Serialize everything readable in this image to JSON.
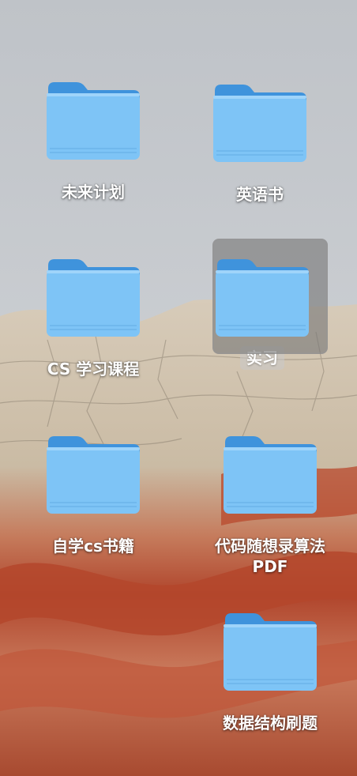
{
  "desktop": {
    "folders": [
      {
        "label": "未来计划"
      },
      {
        "label": "英语书"
      },
      {
        "label": "CS 学习课程"
      },
      {
        "label": "实习",
        "selected": true
      },
      {
        "label": "自学cs书籍"
      },
      {
        "label": "代码随想录算法\nPDF"
      },
      {
        "label": "数据结构刷题"
      }
    ]
  },
  "colors": {
    "folder_back": "#3a8fd9",
    "folder_front": "#7cc4f6",
    "sky": "#c4c8cd",
    "rock_light": "#d8cdbd",
    "rock_red": "#b84c2d"
  },
  "icons": {
    "folder": "folder-icon"
  }
}
